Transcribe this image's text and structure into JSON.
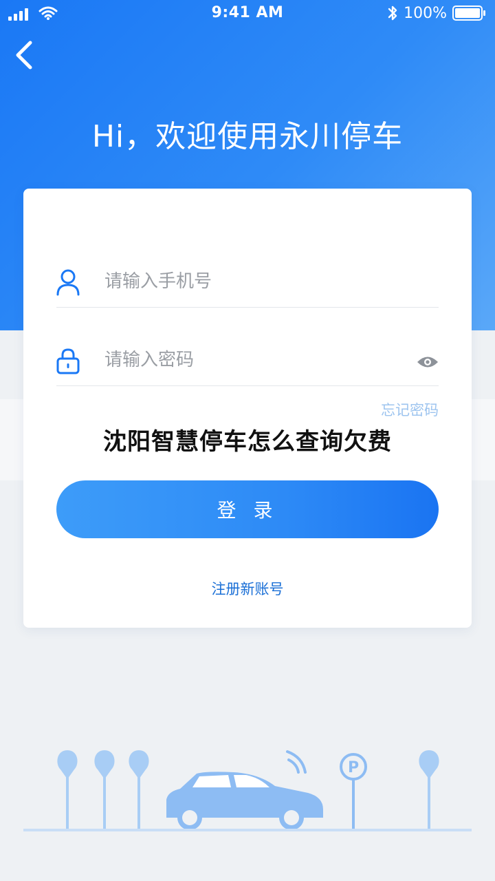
{
  "status_bar": {
    "time": "9:41 AM",
    "battery": "100%",
    "icons": [
      "signal-icon",
      "wifi-icon",
      "bluetooth-icon",
      "battery-icon"
    ]
  },
  "header": {
    "back_icon": "chevron-left-icon",
    "title": "Hi，欢迎使用永川停车"
  },
  "login_form": {
    "phone_placeholder": "请输入手机号",
    "password_placeholder": "请输入密码",
    "forgot_password": "忘记密码",
    "login_button": "登 录",
    "register_link": "注册新账号",
    "icons": [
      "user-icon",
      "lock-icon",
      "eye-icon"
    ]
  },
  "overlay_caption": "沈阳智慧停车怎么查询欠费",
  "colors": {
    "primary": "#2f8bf7",
    "link": "#1a6fd6",
    "forgot": "#9dc4ef",
    "background": "#eef1f4"
  }
}
